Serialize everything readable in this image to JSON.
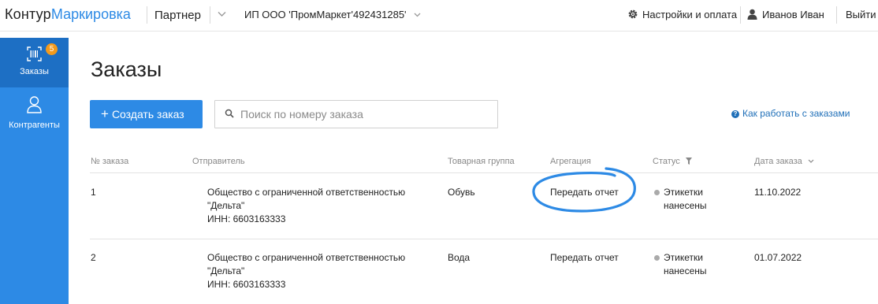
{
  "header": {
    "logo_main": "Контур",
    "logo_product": "Маркировка",
    "role": "Партнер",
    "organization": "ИП ООО 'ПромМаркет'492431285'",
    "settings": "Настройки и оплата",
    "user": "Иванов Иван",
    "logout": "Выйти"
  },
  "sidebar": {
    "items": [
      {
        "label": "Заказы",
        "badge": "5",
        "icon": "barcode-icon"
      },
      {
        "label": "Контрагенты",
        "icon": "person-icon"
      }
    ]
  },
  "main": {
    "title": "Заказы",
    "create_button": "Создать заказ",
    "search_placeholder": "Поиск по номеру заказа",
    "help_link": "Как работать с заказами"
  },
  "table": {
    "columns": [
      "№ заказа",
      "Отправитель",
      "Товарная группа",
      "Агрегация",
      "Статус",
      "Дата заказа"
    ],
    "rows": [
      {
        "number": "1",
        "sender_line1": "Общество с ограниченной ответственностью",
        "sender_line2": "\"Дельта\"",
        "sender_inn": "ИНН: 6603163333",
        "group": "Обувь",
        "aggregation": "Передать отчет",
        "status_line1": "Этикетки",
        "status_line2": "нанесены",
        "date": "11.10.2022"
      },
      {
        "number": "2",
        "sender_line1": "Общество с ограниченной ответственностью",
        "sender_line2": "\"Дельта\"",
        "sender_inn": "ИНН: 6603163333",
        "group": "Вода",
        "aggregation": "Передать отчет",
        "status_line1": "Этикетки",
        "status_line2": "нанесены",
        "date": "01.07.2022"
      }
    ]
  },
  "colors": {
    "accent": "#2d8ae5",
    "badge": "#f39a1c",
    "annotation": "#2d8ae5"
  }
}
